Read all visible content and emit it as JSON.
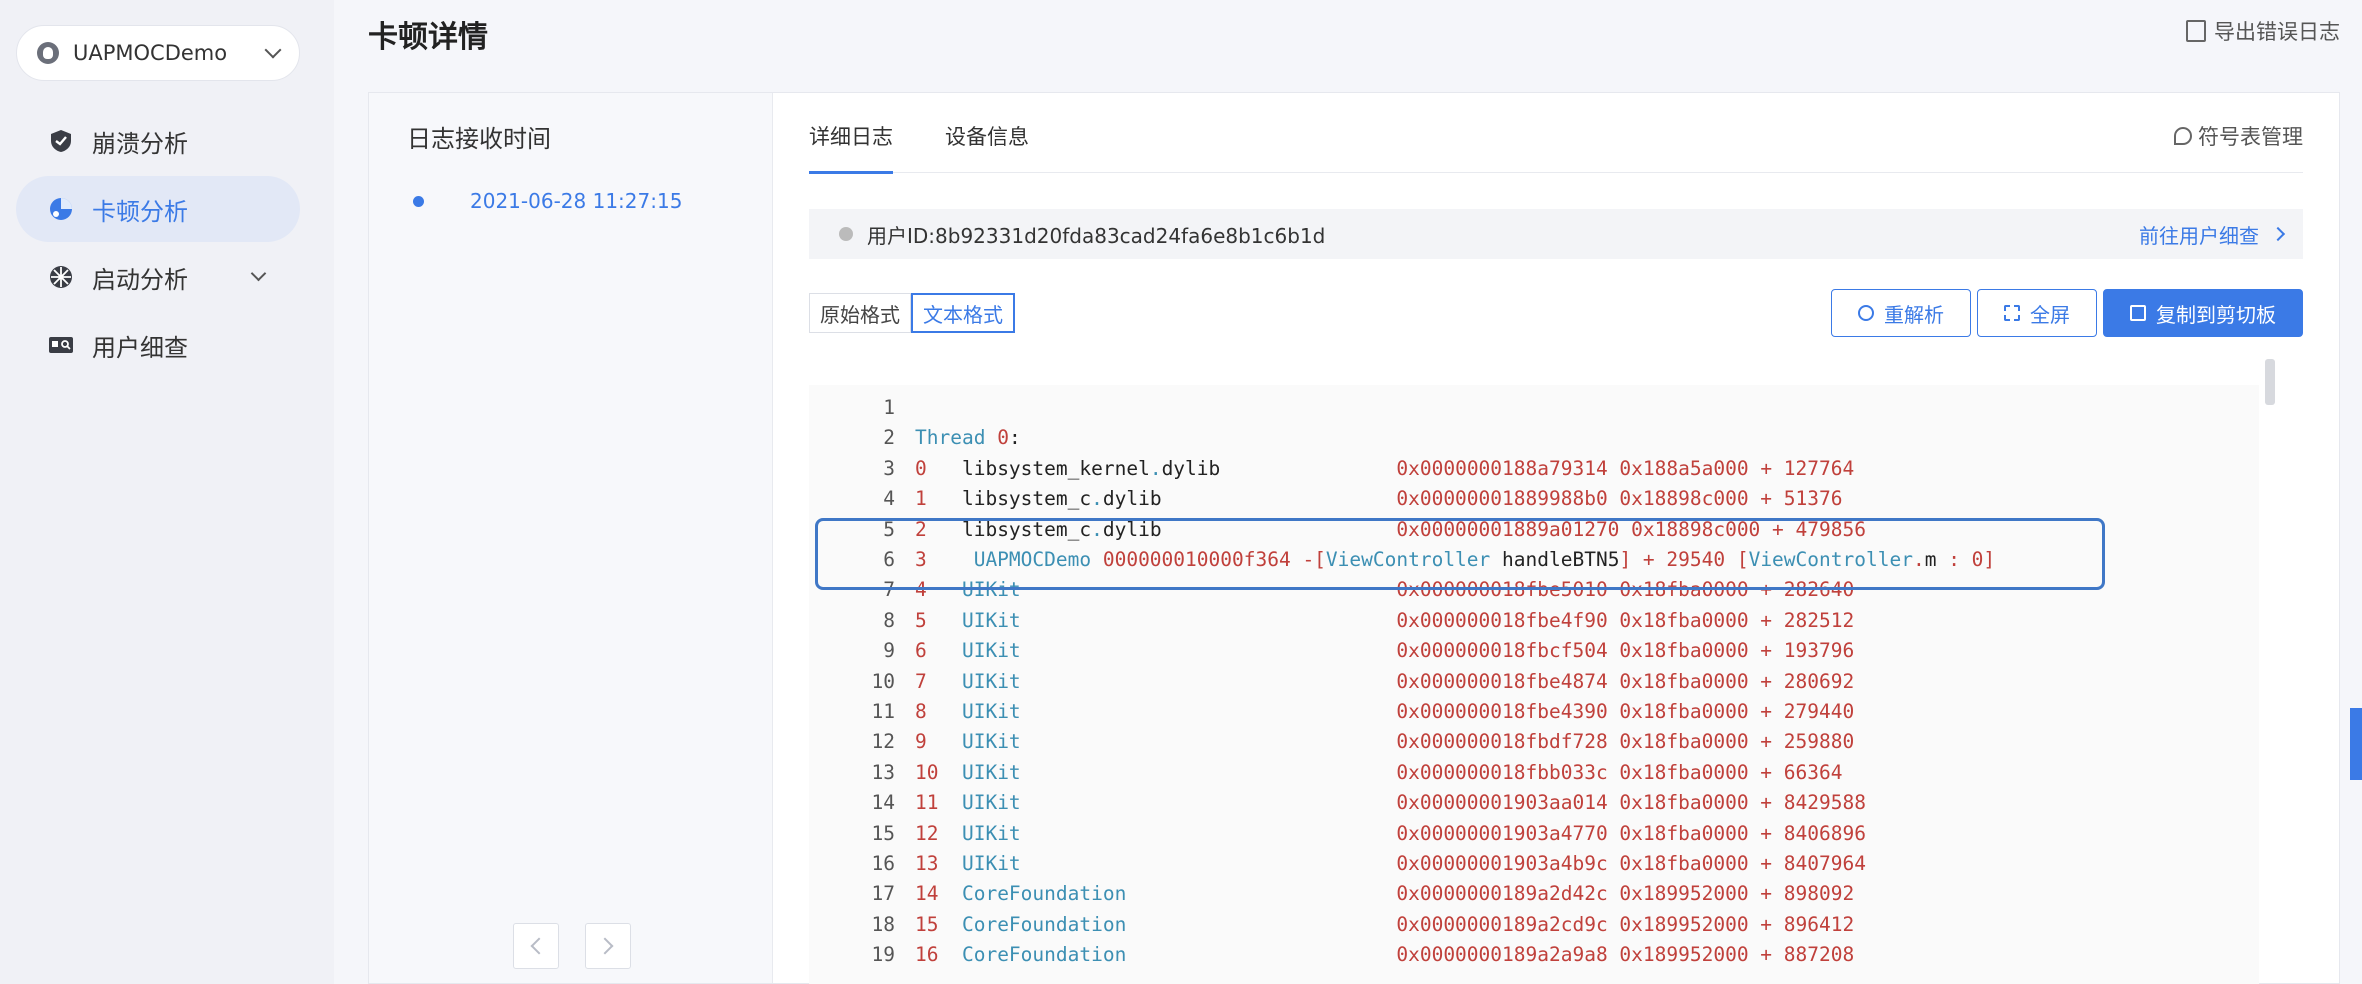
{
  "sidebar": {
    "app_name": "UAPMOCDemo",
    "items": [
      {
        "label": "崩溃分析",
        "icon": "shield-icon"
      },
      {
        "label": "卡顿分析",
        "icon": "stutter-chart-icon"
      },
      {
        "label": "启动分析",
        "icon": "launch-icon"
      },
      {
        "label": "用户细查",
        "icon": "user-card-icon"
      }
    ]
  },
  "header": {
    "title": "卡顿详情",
    "export_label": "导出错误日志"
  },
  "left_panel": {
    "title": "日志接收时间",
    "log_time": "2021-06-28 11:27:15"
  },
  "right_panel": {
    "tabs": [
      "详细日志",
      "设备信息"
    ],
    "symbol_label": "符号表管理",
    "user_id": "用户ID:8b92331d20fda83cad24fa6e8b1c6b1d",
    "goto_user_label": "前往用户细查",
    "format_buttons": [
      "原始格式",
      "文本格式"
    ],
    "actions": {
      "reparse": "重解析",
      "fullscreen": "全屏",
      "copy": "复制到剪切板"
    }
  },
  "colors": {
    "accent": "#3b7ae6",
    "highlight_border": "#3f77c6",
    "func_blue": "#3c8fb3",
    "addr_red": "#c0403b"
  },
  "log_lines": [
    {
      "n": "1",
      "parts": []
    },
    {
      "n": "2",
      "parts": [
        {
          "t": "Thread ",
          "c": "c-blue"
        },
        {
          "t": "0",
          "c": "c-red"
        },
        {
          "t": ":",
          "c": "c-black"
        }
      ]
    },
    {
      "n": "3",
      "parts": [
        {
          "t": "0   ",
          "c": "c-red"
        },
        {
          "t": "libsystem_kernel",
          "c": "c-black"
        },
        {
          "t": ".",
          "c": "c-blue"
        },
        {
          "t": "dylib               ",
          "c": "c-black"
        },
        {
          "t": "0x0000000188a79314 0x188a5a000 + 127764",
          "c": "c-red"
        }
      ]
    },
    {
      "n": "4",
      "parts": [
        {
          "t": "1   ",
          "c": "c-red"
        },
        {
          "t": "libsystem_c",
          "c": "c-black"
        },
        {
          "t": ".",
          "c": "c-blue"
        },
        {
          "t": "dylib                    ",
          "c": "c-black"
        },
        {
          "t": "0x00000001889988b0 0x18898c000 + 51376",
          "c": "c-red"
        }
      ]
    },
    {
      "n": "5",
      "parts": [
        {
          "t": "2   ",
          "c": "c-red"
        },
        {
          "t": "libsystem_c",
          "c": "c-black"
        },
        {
          "t": ".",
          "c": "c-blue"
        },
        {
          "t": "dylib                    ",
          "c": "c-black"
        },
        {
          "t": "0x00000001889a01270 0x18898c000 + 479856",
          "c": "c-red"
        }
      ]
    },
    {
      "n": "6",
      "parts": [
        {
          "t": "3    ",
          "c": "c-red"
        },
        {
          "t": "UAPMOCDemo ",
          "c": "c-blue"
        },
        {
          "t": "000000010000f364 ",
          "c": "c-red"
        },
        {
          "t": "-[",
          "c": "c-red"
        },
        {
          "t": "ViewController ",
          "c": "c-blue"
        },
        {
          "t": "handleBTN5",
          "c": "c-black"
        },
        {
          "t": "] + 29540 [",
          "c": "c-red"
        },
        {
          "t": "ViewController",
          "c": "c-blue"
        },
        {
          "t": ".",
          "c": "c-red"
        },
        {
          "t": "m",
          "c": "c-black"
        },
        {
          "t": " : 0]",
          "c": "c-red"
        }
      ]
    },
    {
      "n": "7",
      "parts": [
        {
          "t": "4   ",
          "c": "c-red"
        },
        {
          "t": "UIKit                                ",
          "c": "c-blue"
        },
        {
          "t": "0x000000018fbe5010 0x18fba0000 + 282640",
          "c": "c-red"
        }
      ]
    },
    {
      "n": "8",
      "parts": [
        {
          "t": "5   ",
          "c": "c-red"
        },
        {
          "t": "UIKit                                ",
          "c": "c-blue"
        },
        {
          "t": "0x000000018fbe4f90 0x18fba0000 + 282512",
          "c": "c-red"
        }
      ]
    },
    {
      "n": "9",
      "parts": [
        {
          "t": "6   ",
          "c": "c-red"
        },
        {
          "t": "UIKit                                ",
          "c": "c-blue"
        },
        {
          "t": "0x000000018fbcf504 0x18fba0000 + 193796",
          "c": "c-red"
        }
      ]
    },
    {
      "n": "10",
      "parts": [
        {
          "t": "7   ",
          "c": "c-red"
        },
        {
          "t": "UIKit                                ",
          "c": "c-blue"
        },
        {
          "t": "0x000000018fbe4874 0x18fba0000 + 280692",
          "c": "c-red"
        }
      ]
    },
    {
      "n": "11",
      "parts": [
        {
          "t": "8   ",
          "c": "c-red"
        },
        {
          "t": "UIKit                                ",
          "c": "c-blue"
        },
        {
          "t": "0x000000018fbe4390 0x18fba0000 + 279440",
          "c": "c-red"
        }
      ]
    },
    {
      "n": "12",
      "parts": [
        {
          "t": "9   ",
          "c": "c-red"
        },
        {
          "t": "UIKit                                ",
          "c": "c-blue"
        },
        {
          "t": "0x000000018fbdf728 0x18fba0000 + 259880",
          "c": "c-red"
        }
      ]
    },
    {
      "n": "13",
      "parts": [
        {
          "t": "10  ",
          "c": "c-red"
        },
        {
          "t": "UIKit                                ",
          "c": "c-blue"
        },
        {
          "t": "0x000000018fbb033c 0x18fba0000 + 66364",
          "c": "c-red"
        }
      ]
    },
    {
      "n": "14",
      "parts": [
        {
          "t": "11  ",
          "c": "c-red"
        },
        {
          "t": "UIKit                                ",
          "c": "c-blue"
        },
        {
          "t": "0x00000001903aa014 0x18fba0000 + 8429588",
          "c": "c-red"
        }
      ]
    },
    {
      "n": "15",
      "parts": [
        {
          "t": "12  ",
          "c": "c-red"
        },
        {
          "t": "UIKit                                ",
          "c": "c-blue"
        },
        {
          "t": "0x00000001903a4770 0x18fba0000 + 8406896",
          "c": "c-red"
        }
      ]
    },
    {
      "n": "16",
      "parts": [
        {
          "t": "13  ",
          "c": "c-red"
        },
        {
          "t": "UIKit                                ",
          "c": "c-blue"
        },
        {
          "t": "0x00000001903a4b9c 0x18fba0000 + 8407964",
          "c": "c-red"
        }
      ]
    },
    {
      "n": "17",
      "parts": [
        {
          "t": "14  ",
          "c": "c-red"
        },
        {
          "t": "CoreFoundation                       ",
          "c": "c-blue"
        },
        {
          "t": "0x0000000189a2d42c 0x189952000 + 898092",
          "c": "c-red"
        }
      ]
    },
    {
      "n": "18",
      "parts": [
        {
          "t": "15  ",
          "c": "c-red"
        },
        {
          "t": "CoreFoundation                       ",
          "c": "c-blue"
        },
        {
          "t": "0x0000000189a2cd9c 0x189952000 + 896412",
          "c": "c-red"
        }
      ]
    },
    {
      "n": "19",
      "parts": [
        {
          "t": "16  ",
          "c": "c-red"
        },
        {
          "t": "CoreFoundation                       ",
          "c": "c-blue"
        },
        {
          "t": "0x0000000189a2a9a8 0x189952000 + 887208",
          "c": "c-red"
        }
      ]
    }
  ]
}
